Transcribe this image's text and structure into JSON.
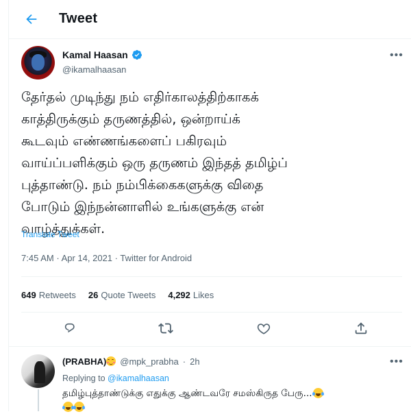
{
  "header": {
    "title": "Tweet",
    "back_icon": "arrow-left-icon"
  },
  "tweet": {
    "author_name": "Kamal Haasan",
    "author_handle": "@ikamalhaasan",
    "verified": true,
    "text": "தேர்தல் முடிந்து நம் எதிர்காலத்திற்காகக்\nகாத்திருக்கும் தருணத்தில், ஒன்றாய்க்\nகூடவும் எண்ணங்களைப் பகிரவும்\nவாய்ப்பளிக்கும் ஒரு தருணம் இந்தத் தமிழ்ப்\nபுத்தாண்டு. நம் நம்பிக்கைகளுக்கு விதை\nபோடும் இந்நன்னாளில் உங்களுக்கு என்\nவாழ்த்துக்கள்.",
    "translate_label": "Translate Tweet",
    "time": "7:45 AM",
    "date": "Apr 14, 2021",
    "source": "Twitter for Android",
    "separator": "·",
    "stats": {
      "retweets_count": "649",
      "retweets_label": "Retweets",
      "quotes_count": "26",
      "quotes_label": "Quote Tweets",
      "likes_count": "4,292",
      "likes_label": "Likes"
    },
    "actions": [
      "reply-icon",
      "retweet-icon",
      "like-icon",
      "share-icon"
    ]
  },
  "reply": {
    "author_name": "(PRABHA)",
    "author_handle": "@mpk_prabha",
    "separator": "·",
    "time_ago": "2h",
    "replying_prefix": "Replying to",
    "replying_to": "@ikamalhaasan",
    "text": "தமிழ்புத்தாண்டுக்கு எதுக்கு ஆண்டவரே சமஸ்கிருத பேரு..."
  },
  "colors": {
    "accent": "#1d9bf0",
    "secondary_text": "#536471",
    "divider": "#eff3f4"
  }
}
